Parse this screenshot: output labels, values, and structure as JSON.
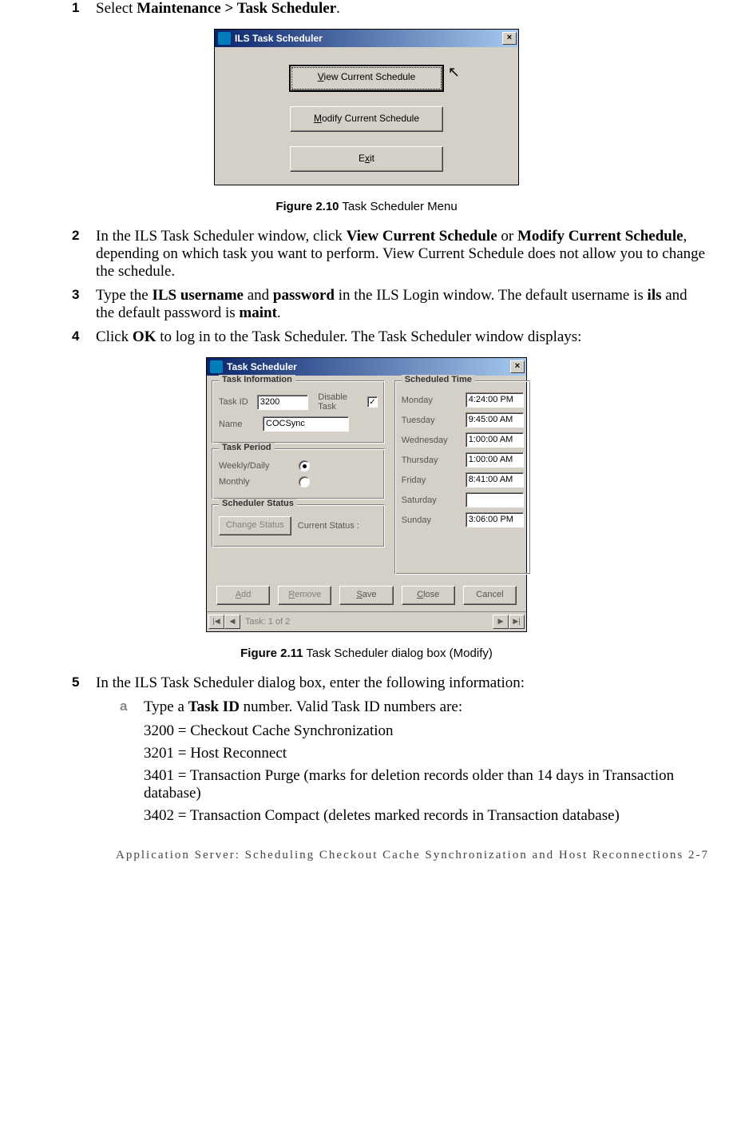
{
  "steps": {
    "s1": {
      "num": "1",
      "pre": "Select ",
      "bold": "Maintenance > Task Scheduler",
      "post": "."
    },
    "s2": {
      "num": "2",
      "pre": "In the ILS Task Scheduler window, click ",
      "b1": "View Current Schedule",
      "mid": " or ",
      "b2": "Modify Current Schedule",
      "post": ", depending on which task you want to perform. View Current Schedule does not allow you to change the schedule."
    },
    "s3": {
      "num": "3",
      "pre": "Type the ",
      "b1": "ILS username",
      "mid1": " and ",
      "b2": "password",
      "mid2": " in the ILS Login window. The default username is ",
      "b3": "ils",
      "mid3": " and the default password is ",
      "b4": "maint",
      "post": "."
    },
    "s4": {
      "num": "4",
      "pre": "Click ",
      "b1": "OK",
      "post": " to log in to the Task Scheduler. The Task Scheduler window displays:"
    },
    "s5": {
      "num": "5",
      "text": "In the ILS Task Scheduler dialog box, enter the following information:",
      "a": {
        "letter": "a",
        "pre": "Type a ",
        "b": "Task ID",
        "post": " number. Valid Task ID numbers are:"
      },
      "lines": [
        "3200 = Checkout Cache Synchronization",
        "3201 = Host Reconnect",
        "3401 = Transaction Purge (marks for deletion records older than 14 days in Transaction database)",
        "3402 = Transaction Compact (deletes marked records in Transaction database)"
      ]
    }
  },
  "fig1": {
    "label": "Figure 2.10",
    "text": " Task Scheduler Menu"
  },
  "fig2": {
    "label": "Figure 2.11",
    "text": " Task Scheduler dialog box (Modify)"
  },
  "dlg1": {
    "title": "ILS Task Scheduler",
    "view_u": "V",
    "view_rest": "iew Current Schedule",
    "modify_u": "M",
    "modify_rest": "odify Current Schedule",
    "exit_pre": "E",
    "exit_u": "x",
    "exit_rest": "it"
  },
  "dlg2": {
    "title": "Task Scheduler",
    "grp_info": "Task Information",
    "lbl_taskid": "Task ID",
    "val_taskid": "3200",
    "lbl_disable": "Disable Task",
    "chk_mark": "✓",
    "lbl_name": "Name",
    "val_name": "COCSync",
    "grp_period": "Task Period",
    "lbl_weekly": "Weekly/Daily",
    "lbl_monthly": "Monthly",
    "grp_status": "Scheduler Status",
    "btn_change": "Change Status",
    "lbl_curstatus": "Current Status :",
    "grp_time": "Scheduled Time",
    "days": {
      "mon": {
        "lbl": "Monday",
        "val": "4:24:00 PM"
      },
      "tue": {
        "lbl": "Tuesday",
        "val": "9:45:00 AM"
      },
      "wed": {
        "lbl": "Wednesday",
        "val": "1:00:00 AM"
      },
      "thu": {
        "lbl": "Thursday",
        "val": "1:00:00 AM"
      },
      "fri": {
        "lbl": "Friday",
        "val": "8:41:00 AM"
      },
      "sat": {
        "lbl": "Saturday",
        "val": ""
      },
      "sun": {
        "lbl": "Sunday",
        "val": "3:06:00 PM"
      }
    },
    "btns": {
      "add_u": "A",
      "add_rest": "dd",
      "remove_u": "R",
      "remove_rest": "emove",
      "save_u": "S",
      "save_rest": "ave",
      "close_u": "C",
      "close_rest": "lose",
      "cancel": "Cancel"
    },
    "nav": "Task: 1 of 2"
  },
  "footer": "Application Server: Scheduling Checkout Cache Synchronization and Host Reconnections 2-7"
}
